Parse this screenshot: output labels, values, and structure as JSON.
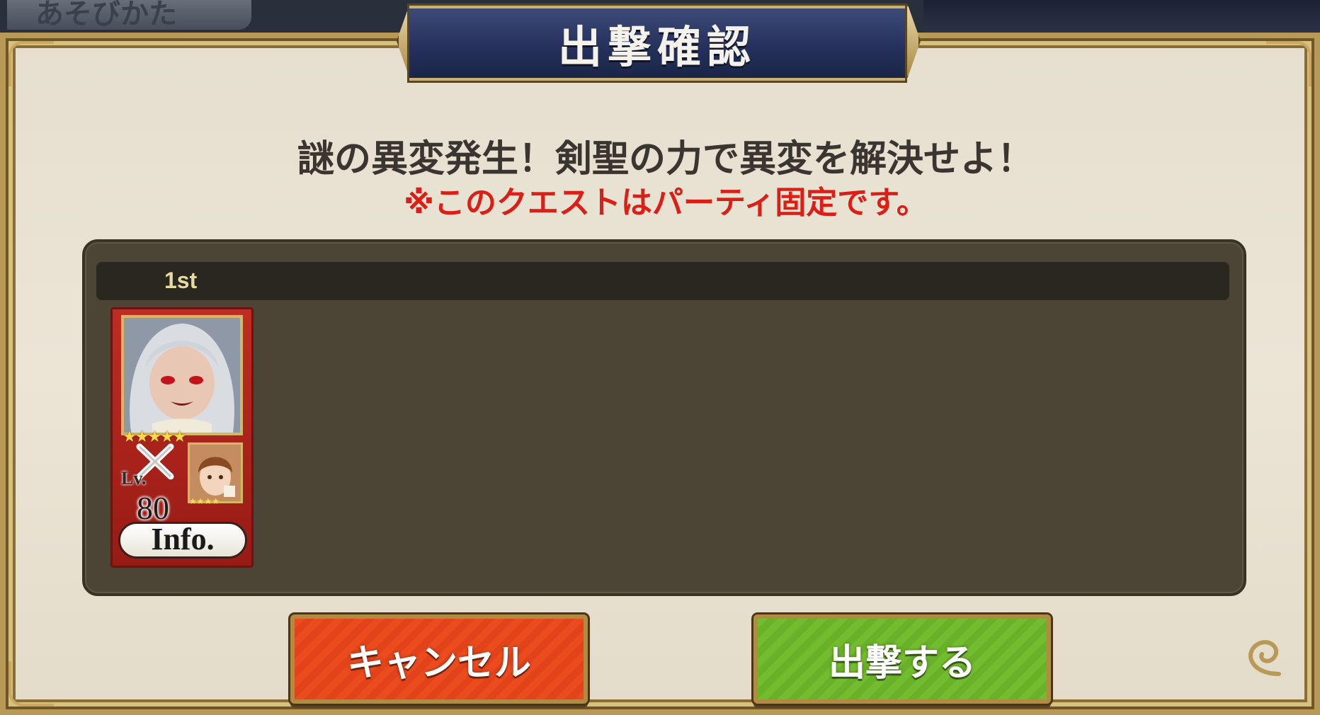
{
  "background": {
    "tab_text": "あそびかた"
  },
  "dialog": {
    "title": "出撃確認",
    "message": "謎の異変発生！剣聖の力で異変を解決せよ！",
    "warning": "※このクエストはパーティ固定です。"
  },
  "party": {
    "label": "1st",
    "units": [
      {
        "stars": "★★★★★",
        "level_label": "Lv.",
        "level": "80",
        "info_label": "Info.",
        "sub_stars": "★★★★"
      }
    ]
  },
  "buttons": {
    "cancel": "キャンセル",
    "sortie": "出撃する"
  },
  "colors": {
    "title_banner": "#24305a",
    "warning": "#dc1e17",
    "cancel_button": "#e44a1d",
    "sortie_button": "#6db52a"
  }
}
